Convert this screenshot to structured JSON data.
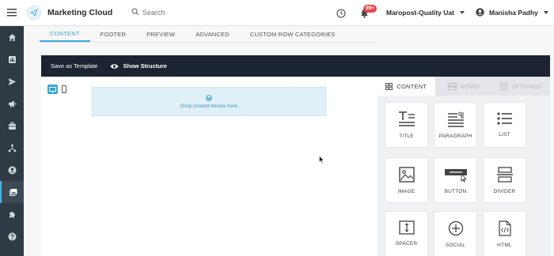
{
  "header": {
    "app_title": "Marketing Cloud",
    "search_placeholder": "Search",
    "notification_count": "99+",
    "account_name": "Maropost-Quality Uat",
    "user_name": "Manisha Padhy"
  },
  "tabs": [
    {
      "label": "CONTENT",
      "active": true
    },
    {
      "label": "FOOTER"
    },
    {
      "label": "PREVIEW"
    },
    {
      "label": "ADVANCED"
    },
    {
      "label": "CUSTOM ROW CATEGORIES"
    }
  ],
  "actionbar": {
    "save_template": "Save as Template",
    "show_structure": "Show Structure"
  },
  "canvas": {
    "drop_hint": "Drop content blocks here"
  },
  "panel": {
    "tabs": [
      {
        "label": "CONTENT",
        "icon": "grid-icon",
        "active": true
      },
      {
        "label": "ROWS",
        "icon": "rows-icon"
      },
      {
        "label": "SETTINGS",
        "icon": "settings-panel-icon"
      }
    ],
    "blocks": [
      {
        "label": "TITLE",
        "icon": "title-icon"
      },
      {
        "label": "PARAGRAPH",
        "icon": "paragraph-icon"
      },
      {
        "label": "LIST",
        "icon": "list-icon"
      },
      {
        "label": "IMAGE",
        "icon": "image-icon"
      },
      {
        "label": "BUTTON",
        "icon": "button-icon"
      },
      {
        "label": "DIVIDER",
        "icon": "divider-icon"
      },
      {
        "label": "SPACER",
        "icon": "spacer-icon"
      },
      {
        "label": "SOCIAL",
        "icon": "social-icon"
      },
      {
        "label": "HTML",
        "icon": "html-icon"
      }
    ]
  },
  "colors": {
    "accent": "#3aa6d6",
    "sidebar": "#2f3a44",
    "actionbar": "#1b2430",
    "badge": "#e5484d"
  }
}
